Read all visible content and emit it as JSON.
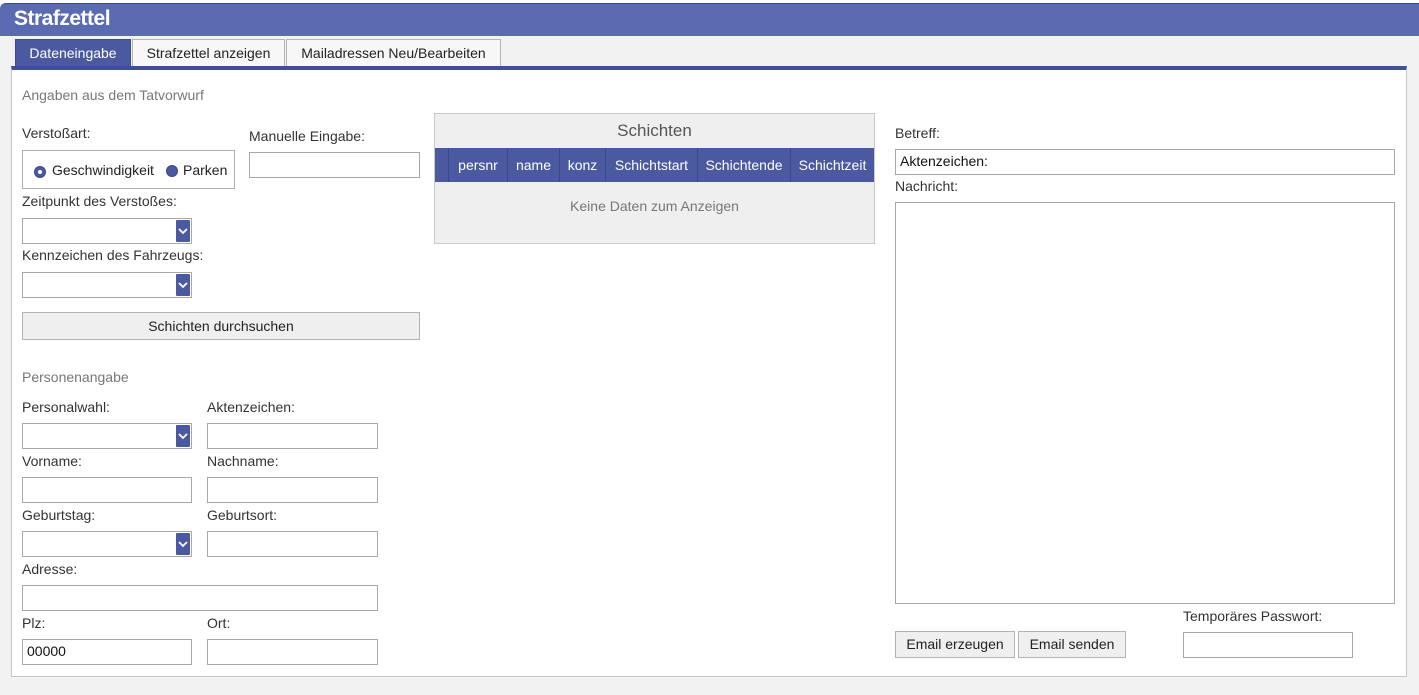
{
  "app": {
    "title": "Strafzettel"
  },
  "tabs": [
    {
      "label": "Dateneingabe",
      "active": true
    },
    {
      "label": "Strafzettel anzeigen",
      "active": false
    },
    {
      "label": "Mailadressen Neu/Bearbeiten",
      "active": false
    }
  ],
  "tatvorwurf": {
    "section_label": "Angaben aus dem Tatvorwurf",
    "verstossart_label": "Verstoßart:",
    "radio_options": [
      {
        "label": "Geschwindigkeit",
        "selected": true
      },
      {
        "label": "Parken",
        "selected": false
      }
    ],
    "manuelle_label": "Manuelle Eingabe:",
    "manuelle_value": "",
    "zeitpunkt_label": "Zeitpunkt des Verstoßes:",
    "zeitpunkt_value": "",
    "kennzeichen_label": "Kennzeichen des Fahrzeugs:",
    "kennzeichen_value": "",
    "search_button": "Schichten durchsuchen"
  },
  "schichten": {
    "caption": "Schichten",
    "columns": [
      "persnr",
      "name",
      "konz",
      "Schichtstart",
      "Schichtende",
      "Schichtzeit"
    ],
    "rows": [],
    "empty_text": "Keine Daten zum Anzeigen"
  },
  "person": {
    "section_label": "Personenangabe",
    "personalwahl_label": "Personalwahl:",
    "personalwahl_value": "",
    "aktenzeichen_label": "Aktenzeichen:",
    "aktenzeichen_value": "",
    "vorname_label": "Vorname:",
    "vorname_value": "",
    "nachname_label": "Nachname:",
    "nachname_value": "",
    "geburtstag_label": "Geburtstag:",
    "geburtstag_value": "",
    "geburtsort_label": "Geburtsort:",
    "geburtsort_value": "",
    "adresse_label": "Adresse:",
    "adresse_value": "",
    "plz_label": "Plz:",
    "plz_value": "00000",
    "ort_label": "Ort:",
    "ort_value": ""
  },
  "mail": {
    "betreff_label": "Betreff:",
    "betreff_value": "Aktenzeichen:",
    "nachricht_label": "Nachricht:",
    "nachricht_value": "",
    "email_erzeugen": "Email erzeugen",
    "email_senden": "Email senden",
    "passwort_label": "Temporäres Passwort:",
    "passwort_value": ""
  },
  "colors": {
    "header": "#5b6bb2",
    "accent": "#4b5aa0",
    "panel_top": "#3f4f99"
  }
}
